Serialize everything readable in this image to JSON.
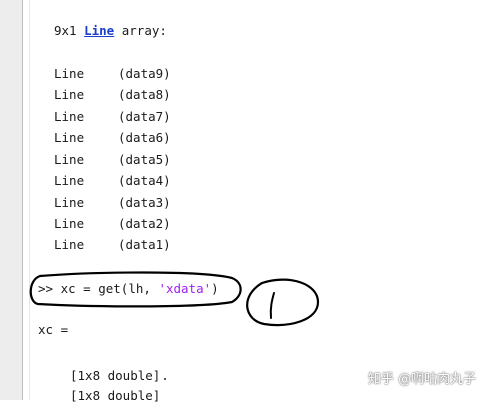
{
  "header": {
    "size": "9x1",
    "link_text": "Line",
    "suffix": "array:"
  },
  "lines": [
    {
      "type": "Line",
      "tag": "(data9)"
    },
    {
      "type": "Line",
      "tag": "(data8)"
    },
    {
      "type": "Line",
      "tag": "(data7)"
    },
    {
      "type": "Line",
      "tag": "(data6)"
    },
    {
      "type": "Line",
      "tag": "(data5)"
    },
    {
      "type": "Line",
      "tag": "(data4)"
    },
    {
      "type": "Line",
      "tag": "(data3)"
    },
    {
      "type": "Line",
      "tag": "(data2)"
    },
    {
      "type": "Line",
      "tag": "(data1)"
    }
  ],
  "command": {
    "prompt": ">>",
    "code_before": "xc = get(lh, ",
    "string_arg": "'xdata'",
    "code_after": ")"
  },
  "annotation": {
    "number": "1"
  },
  "output": {
    "var_line": "xc =",
    "cells": [
      "[1x8 double]",
      "[1x8 double]"
    ]
  },
  "watermark": "知乎 @啊咕肉丸子",
  "colors": {
    "link": "#1a3fcc",
    "string": "#a020f0",
    "text": "#1a1a1a",
    "ink": "#000000"
  }
}
